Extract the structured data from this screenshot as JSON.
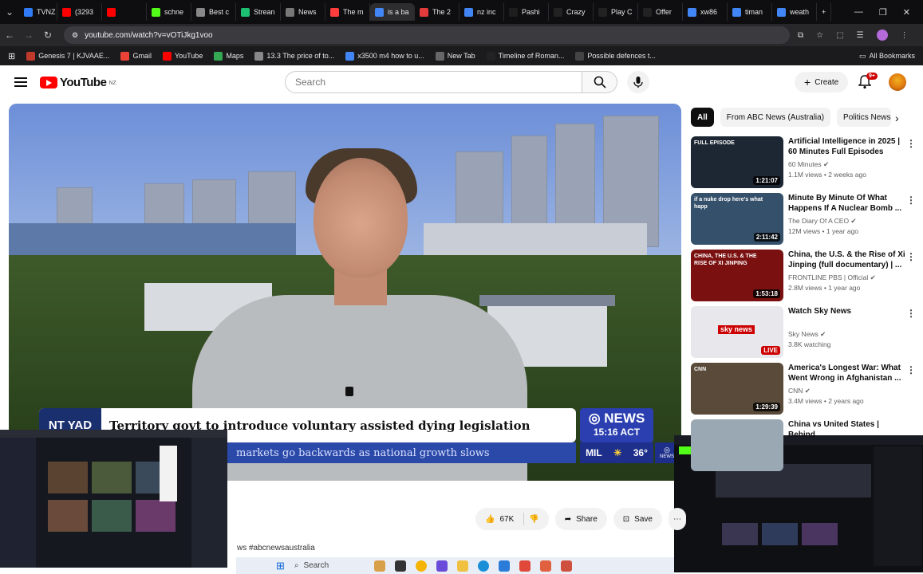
{
  "browser": {
    "tabs": [
      {
        "label": "TVNZ",
        "color": "#2f7cf6"
      },
      {
        "label": "(3293",
        "color": "#ff0000"
      },
      {
        "label": "",
        "color": "#ff0000"
      },
      {
        "label": "schne",
        "color": "#53fc18"
      },
      {
        "label": "Best c",
        "color": "#888888"
      },
      {
        "label": "Strean",
        "color": "#1dbf73"
      },
      {
        "label": "News",
        "color": "#777777"
      },
      {
        "label": "The m",
        "color": "#ff3d3d"
      },
      {
        "label": "is a ba",
        "color": "#4285f4"
      },
      {
        "label": "The 2",
        "color": "#e23b3b"
      },
      {
        "label": "nz inc",
        "color": "#4285f4"
      },
      {
        "label": "Pashi",
        "color": "#1e1e1e"
      },
      {
        "label": "Crazy",
        "color": "#222222"
      },
      {
        "label": "Play C",
        "color": "#222222"
      },
      {
        "label": "Offer",
        "color": "#222222"
      },
      {
        "label": "xw86",
        "color": "#4285f4"
      },
      {
        "label": "timan",
        "color": "#4285f4"
      },
      {
        "label": "weath",
        "color": "#4285f4"
      }
    ],
    "url": "youtube.com/watch?v=vOTiJkg1voo",
    "bookmarks": [
      "Genesis 7 | KJVAAE...",
      "Gmail",
      "YouTube",
      "Maps",
      "13.3 The price of to...",
      "x3500 m4 how to u...",
      "New Tab",
      "Timeline of Roman...",
      "Possible defences t..."
    ],
    "all_bookmarks": "All Bookmarks"
  },
  "youtube": {
    "logo_text": "YouTube",
    "country_code": "NZ",
    "search_placeholder": "Search",
    "create_label": "Create",
    "notif_count": "9+"
  },
  "video": {
    "location_tag": "NT YAD",
    "headline": "Territory govt to introduce voluntary assisted dying legislation",
    "ticker": "markets go backwards as national growth slows",
    "network": "NEWS",
    "time": "15:16 ACT",
    "weather_place": "MIL",
    "weather_temp": "36°",
    "corner_logo": "NEWS"
  },
  "actions": {
    "likes": "67K",
    "share": "Share",
    "save": "Save"
  },
  "hashtags": "ws #abcnewsaustralia",
  "chips": [
    "All",
    "From ABC News (Australia)",
    "Politics News"
  ],
  "recommendations": [
    {
      "title": "Artificial Intelligence in 2025 | 60 Minutes Full Episodes",
      "channel": "60 Minutes",
      "meta": "1.1M views • 2 weeks ago",
      "duration": "1:21:07",
      "badge": "FULL EPISODE",
      "color": "#1c2733"
    },
    {
      "title": "Minute By Minute Of What Happens If A Nuclear Bomb ...",
      "channel": "The Diary Of A CEO",
      "meta": "12M views • 1 year ago",
      "duration": "2:11:42",
      "badge": "if a nuke drop here's what happ",
      "color": "#35506a"
    },
    {
      "title": "China, the U.S. & the Rise of Xi Jinping (full documentary) | ...",
      "channel": "FRONTLINE PBS | Official",
      "meta": "2.8M views • 1 year ago",
      "duration": "1:53:18",
      "badge": "CHINA, THE U.S. & THE RISE OF XI JINPING",
      "color": "#7a1010"
    },
    {
      "title": "Watch Sky News",
      "channel": "Sky News",
      "meta": "3.8K watching",
      "duration": "LIVE",
      "badge": "sky news",
      "color": "#e8e8ec"
    },
    {
      "title": "America's Longest War: What Went Wrong in Afghanistan ...",
      "channel": "CNN",
      "meta": "3.4M views • 2 years ago",
      "duration": "1:29:39",
      "badge": "CNN",
      "color": "#5a4a3a"
    },
    {
      "title": "China vs United States | Behind",
      "channel": "",
      "meta": "",
      "duration": "",
      "badge": "",
      "color": "#9aa8b4"
    }
  ],
  "taskbar": {
    "search": "Search"
  }
}
